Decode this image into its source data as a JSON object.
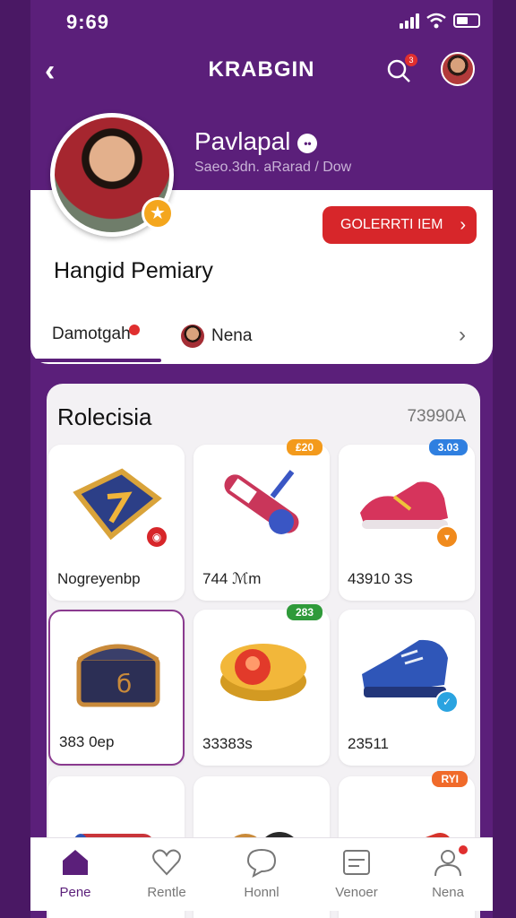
{
  "status_bar": {
    "time": "9:69"
  },
  "app_bar": {
    "title": "KRABGIN",
    "search_badge": "3"
  },
  "profile": {
    "name": "Pavlapal",
    "subtitle": "Saeo.3dn. aRarad / Dow",
    "display_name": "Hangid Pemiary",
    "collect_button": "GOLERRTI IEM",
    "verified_glyph": "••"
  },
  "tabs": [
    {
      "label": "Damotgah"
    },
    {
      "label": "Nena"
    }
  ],
  "collection": {
    "title": "Rolecisia",
    "count": "73990A",
    "items": [
      {
        "label": "Nogreyenbp",
        "tag": "",
        "tag_color": "",
        "badge_color": "#d7262a",
        "icon": "shield-icon"
      },
      {
        "label": "744 ℳm",
        "tag": "₤20",
        "tag_color": "#f39a1c",
        "badge_color": "",
        "icon": "cannon-icon"
      },
      {
        "label": "43910 3S",
        "tag": "3.03",
        "tag_color": "#2f7fe0",
        "badge_color": "#f08a1c",
        "icon": "sneaker-icon"
      },
      {
        "label": "383 0ep",
        "tag": "",
        "tag_color": "",
        "badge_color": "",
        "icon": "chest-icon"
      },
      {
        "label": "33383s",
        "tag": "283",
        "tag_color": "#2f9a3a",
        "badge_color": "",
        "icon": "gold-drum-icon"
      },
      {
        "label": "23511",
        "tag": "",
        "tag_color": "",
        "badge_color": "#2aa3e0",
        "icon": "blue-shoe-icon"
      }
    ],
    "partial_tag": "RYI"
  },
  "bottom_nav": [
    {
      "label": "Pene",
      "icon": "home-icon",
      "active": true
    },
    {
      "label": "Rentle",
      "icon": "heart-icon",
      "active": false
    },
    {
      "label": "Honnl",
      "icon": "chat-icon",
      "active": false
    },
    {
      "label": "Venoer",
      "icon": "card-icon",
      "active": false
    },
    {
      "label": "Nena",
      "icon": "profile-icon",
      "active": false
    }
  ],
  "colors": {
    "primary": "#5b1f7a",
    "accent_red": "#d7262a",
    "badge_orange": "#f4a61d"
  }
}
